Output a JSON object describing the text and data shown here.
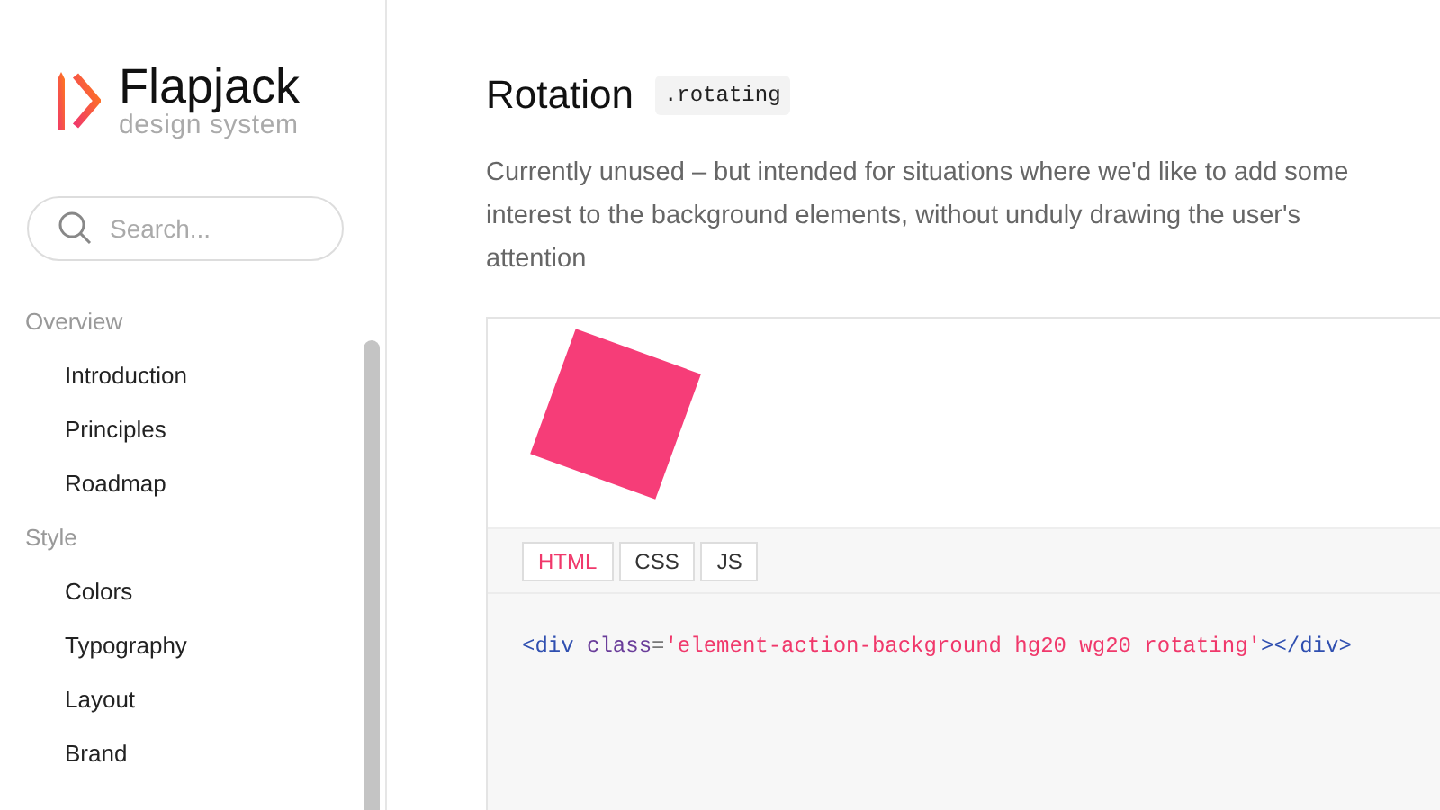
{
  "brand": {
    "name": "Flapjack",
    "tagline": "design system"
  },
  "search": {
    "placeholder": "Search..."
  },
  "nav": [
    {
      "label": "Overview",
      "children": [
        {
          "label": "Introduction"
        },
        {
          "label": "Principles"
        },
        {
          "label": "Roadmap"
        }
      ]
    },
    {
      "label": "Style",
      "children": [
        {
          "label": "Colors"
        },
        {
          "label": "Typography"
        },
        {
          "label": "Layout"
        },
        {
          "label": "Brand"
        }
      ]
    }
  ],
  "section": {
    "title": "Rotation",
    "class_tag": ".rotating",
    "description": "Currently unused – but intended for situations where we'd like to add some interest to the background elements, without unduly drawing the user's attention"
  },
  "demo": {
    "tabs": [
      {
        "label": "HTML",
        "selected": true
      },
      {
        "label": "CSS",
        "selected": false
      },
      {
        "label": "JS",
        "selected": false
      }
    ],
    "code": [
      {
        "kind": "tag",
        "text": "<div"
      },
      {
        "kind": "attr",
        "text": " class"
      },
      {
        "kind": "punct",
        "text": "="
      },
      {
        "kind": "string",
        "text": "'element-action-background hg20 wg20 rotating'"
      },
      {
        "kind": "tag",
        "text": "></div>"
      }
    ]
  }
}
